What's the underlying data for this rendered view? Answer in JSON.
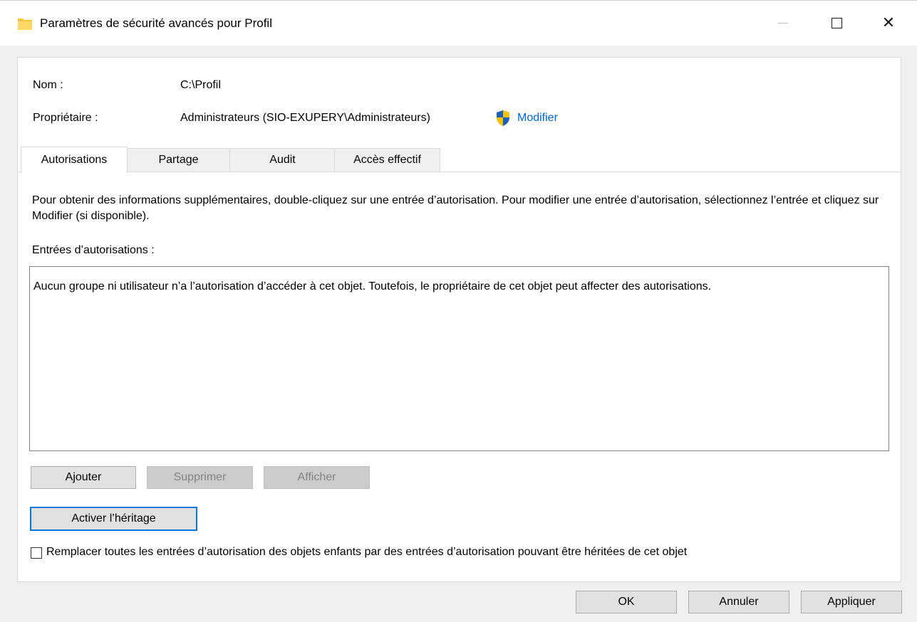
{
  "window": {
    "title": "Paramètres de sécurité avancés pour Profil",
    "icon": "folder-icon"
  },
  "details": {
    "name_label": "Nom :",
    "name_value": "C:\\Profil",
    "owner_label": "Propriétaire :",
    "owner_value": "Administrateurs (SIO-EXUPERY\\Administrateurs)",
    "owner_change_link": "Modifier"
  },
  "tabs": [
    {
      "label": "Autorisations",
      "active": true
    },
    {
      "label": "Partage",
      "active": false
    },
    {
      "label": "Audit",
      "active": false
    },
    {
      "label": "Accès effectif",
      "active": false
    }
  ],
  "permissions": {
    "info_text": "Pour obtenir des informations supplémentaires, double-cliquez sur une entrée d’autorisation. Pour modifier une entrée d’autorisation, sélectionnez l’entrée et cliquez sur Modifier (si disponible).",
    "entries_label": "Entrées d’autorisations :",
    "empty_message": "Aucun groupe ni utilisateur n’a l’autorisation d’accéder à cet objet. Toutefois, le propriétaire de cet objet peut affecter des autorisations.",
    "add_button": "Ajouter",
    "remove_button": "Supprimer",
    "view_button": "Afficher",
    "enable_inheritance_button": "Activer l’héritage",
    "replace_checkbox_label": "Remplacer toutes les entrées d’autorisation des objets enfants par des entrées d’autorisation pouvant être héritées de cet objet",
    "replace_checked": false
  },
  "footer": {
    "ok": "OK",
    "cancel": "Annuler",
    "apply": "Appliquer"
  },
  "colors": {
    "link": "#0066cc",
    "focus_border": "#0078d7",
    "window_bg": "#f0f0f0"
  }
}
